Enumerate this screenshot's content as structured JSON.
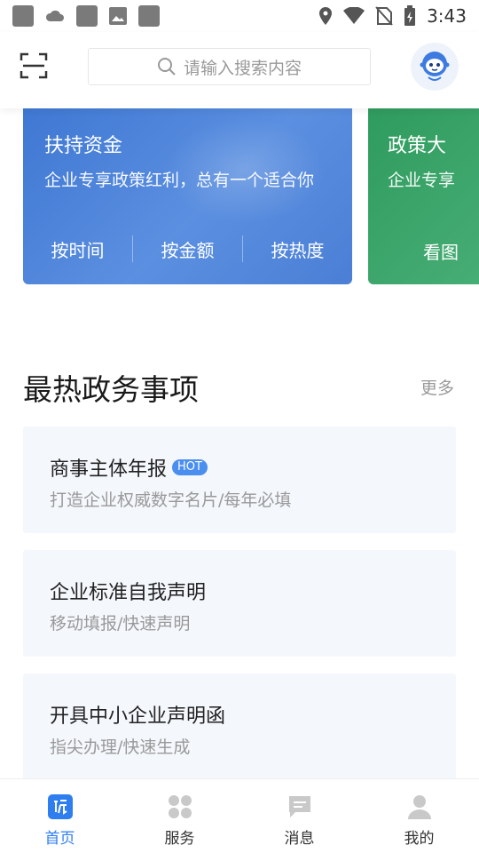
{
  "status_bar": {
    "time": "3:43"
  },
  "header": {
    "search_placeholder": "请输入搜索内容"
  },
  "banners": [
    {
      "title": "扶持资金",
      "subtitle": "企业专享政策红利，总有一个适合你",
      "tabs": [
        "按时间",
        "按金额",
        "按热度"
      ]
    },
    {
      "title": "政策大",
      "subtitle": "企业专享",
      "tabs": [
        "看图"
      ]
    }
  ],
  "section": {
    "title": "最热政务事项",
    "more_label": "更多",
    "items": [
      {
        "title": "商事主体年报",
        "badge": "HOT",
        "subtitle": "打造企业权威数字名片/每年必填"
      },
      {
        "title": "企业标准自我声明",
        "subtitle": "移动填报/快速声明"
      },
      {
        "title": "开具中小企业声明函",
        "subtitle": "指尖办理/快速生成"
      }
    ]
  },
  "bottom_nav": {
    "items": [
      {
        "label": "首页",
        "active": true,
        "icon": "home-doc-icon"
      },
      {
        "label": "服务",
        "active": false,
        "icon": "grid-clover-icon"
      },
      {
        "label": "消息",
        "active": false,
        "icon": "message-bubble-icon"
      },
      {
        "label": "我的",
        "active": false,
        "icon": "person-icon"
      }
    ]
  },
  "colors": {
    "accent": "#2f7ef0",
    "banner_blue": "#4a7fd6",
    "banner_green": "#3aa66b",
    "item_bg": "#f4f7fc"
  }
}
